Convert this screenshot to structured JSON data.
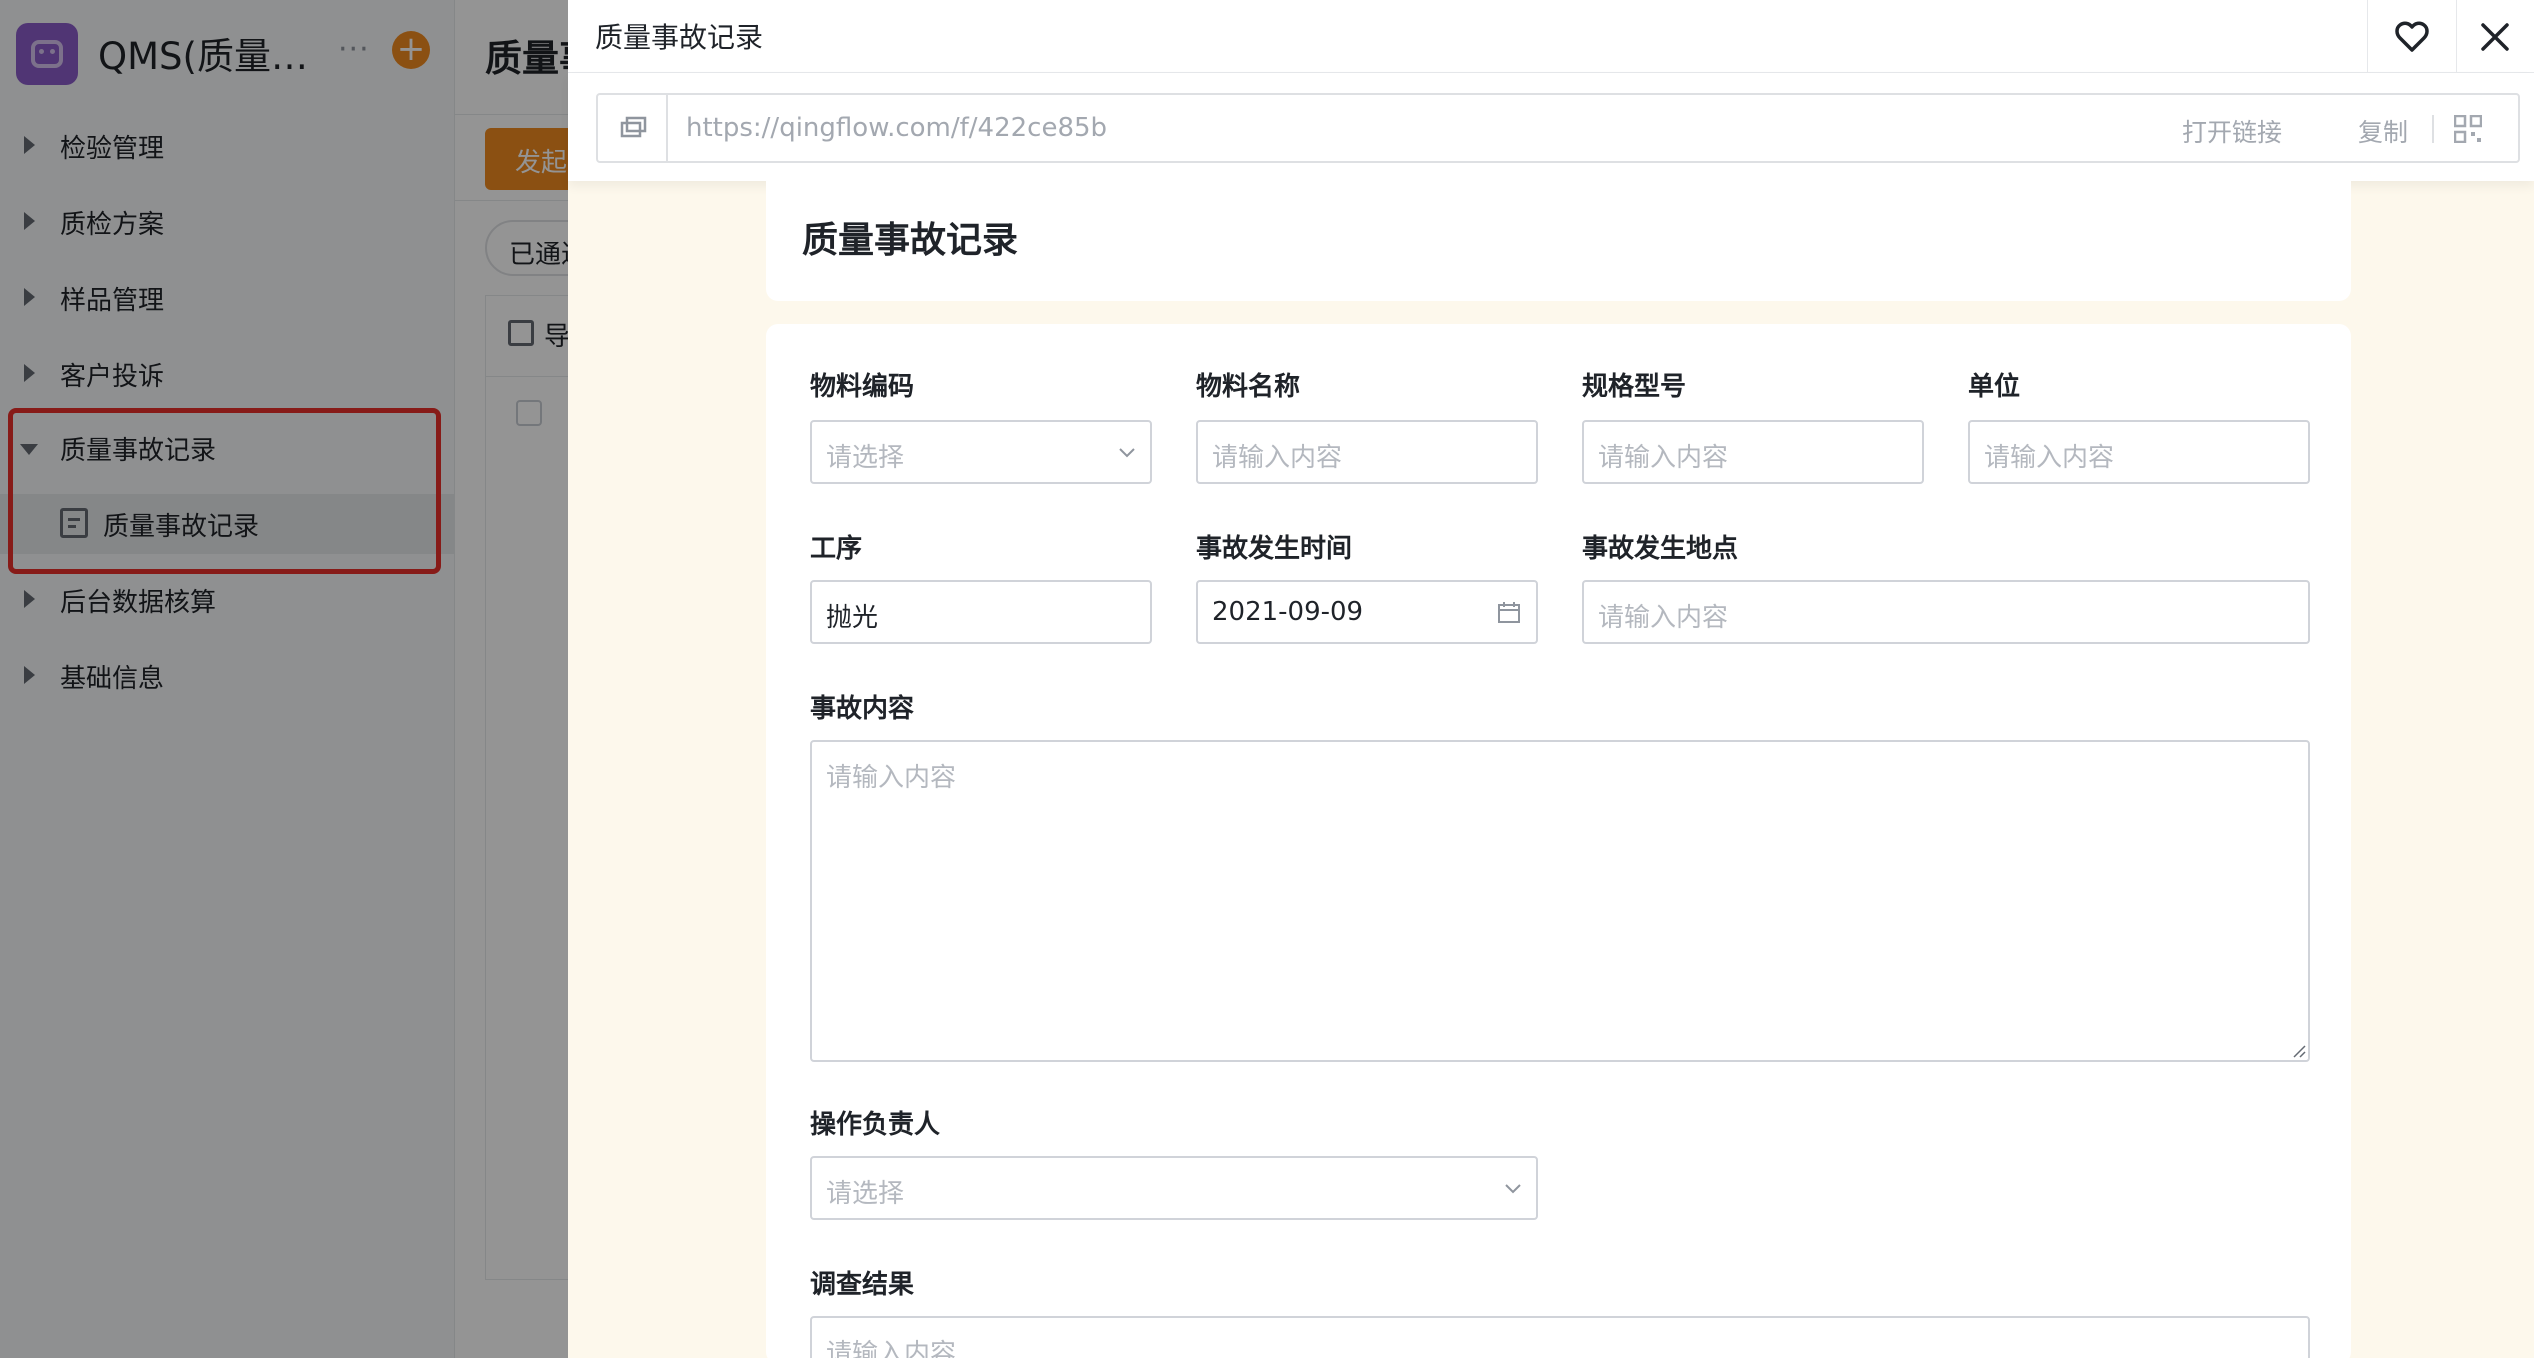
{
  "background_app": {
    "app_name": "QMS(质量…",
    "more_icon": "···",
    "plus_icon": "+",
    "nav": [
      {
        "label": "检验管理"
      },
      {
        "label": "质检方案"
      },
      {
        "label": "样品管理"
      },
      {
        "label": "客户投诉"
      },
      {
        "label": "质量事故记录",
        "expanded": true
      },
      {
        "label": "质量事故记录",
        "sub": true
      },
      {
        "label": "后台数据核算"
      },
      {
        "label": "基础信息"
      }
    ],
    "main_title": "质量事",
    "start_button": "发起",
    "filter_pill": "已通过",
    "export_label": "导"
  },
  "drawer": {
    "title": "质量事故记录",
    "link": {
      "url": "https://qingflow.com/f/422ce85b",
      "open_label": "打开链接",
      "copy_label": "复制"
    },
    "form": {
      "title": "质量事故记录",
      "fields": {
        "material_code": {
          "label": "物料编码",
          "placeholder": "请选择"
        },
        "material_name": {
          "label": "物料名称",
          "placeholder": "请输入内容"
        },
        "spec_model": {
          "label": "规格型号",
          "placeholder": "请输入内容"
        },
        "unit": {
          "label": "单位",
          "placeholder": "请输入内容"
        },
        "process": {
          "label": "工序",
          "value": "抛光"
        },
        "occur_time": {
          "label": "事故发生时间",
          "value": "2021-09-09"
        },
        "occur_place": {
          "label": "事故发生地点",
          "placeholder": "请输入内容"
        },
        "content": {
          "label": "事故内容",
          "placeholder": "请输入内容"
        },
        "owner": {
          "label": "操作负责人",
          "placeholder": "请选择"
        },
        "result": {
          "label": "调查结果",
          "placeholder": "请输入内容"
        }
      }
    }
  },
  "colors": {
    "accent_orange": "#f08b1f",
    "highlight_red": "#e8302a",
    "app_purple": "#8b5cc9",
    "drawer_bg": "#fdf8ec"
  },
  "icons": [
    "app-logo-icon",
    "more-icon",
    "plus-icon",
    "doc-icon",
    "link-icon",
    "qr-code-icon",
    "heart-icon",
    "close-icon",
    "chevron-down-icon",
    "calendar-icon"
  ]
}
